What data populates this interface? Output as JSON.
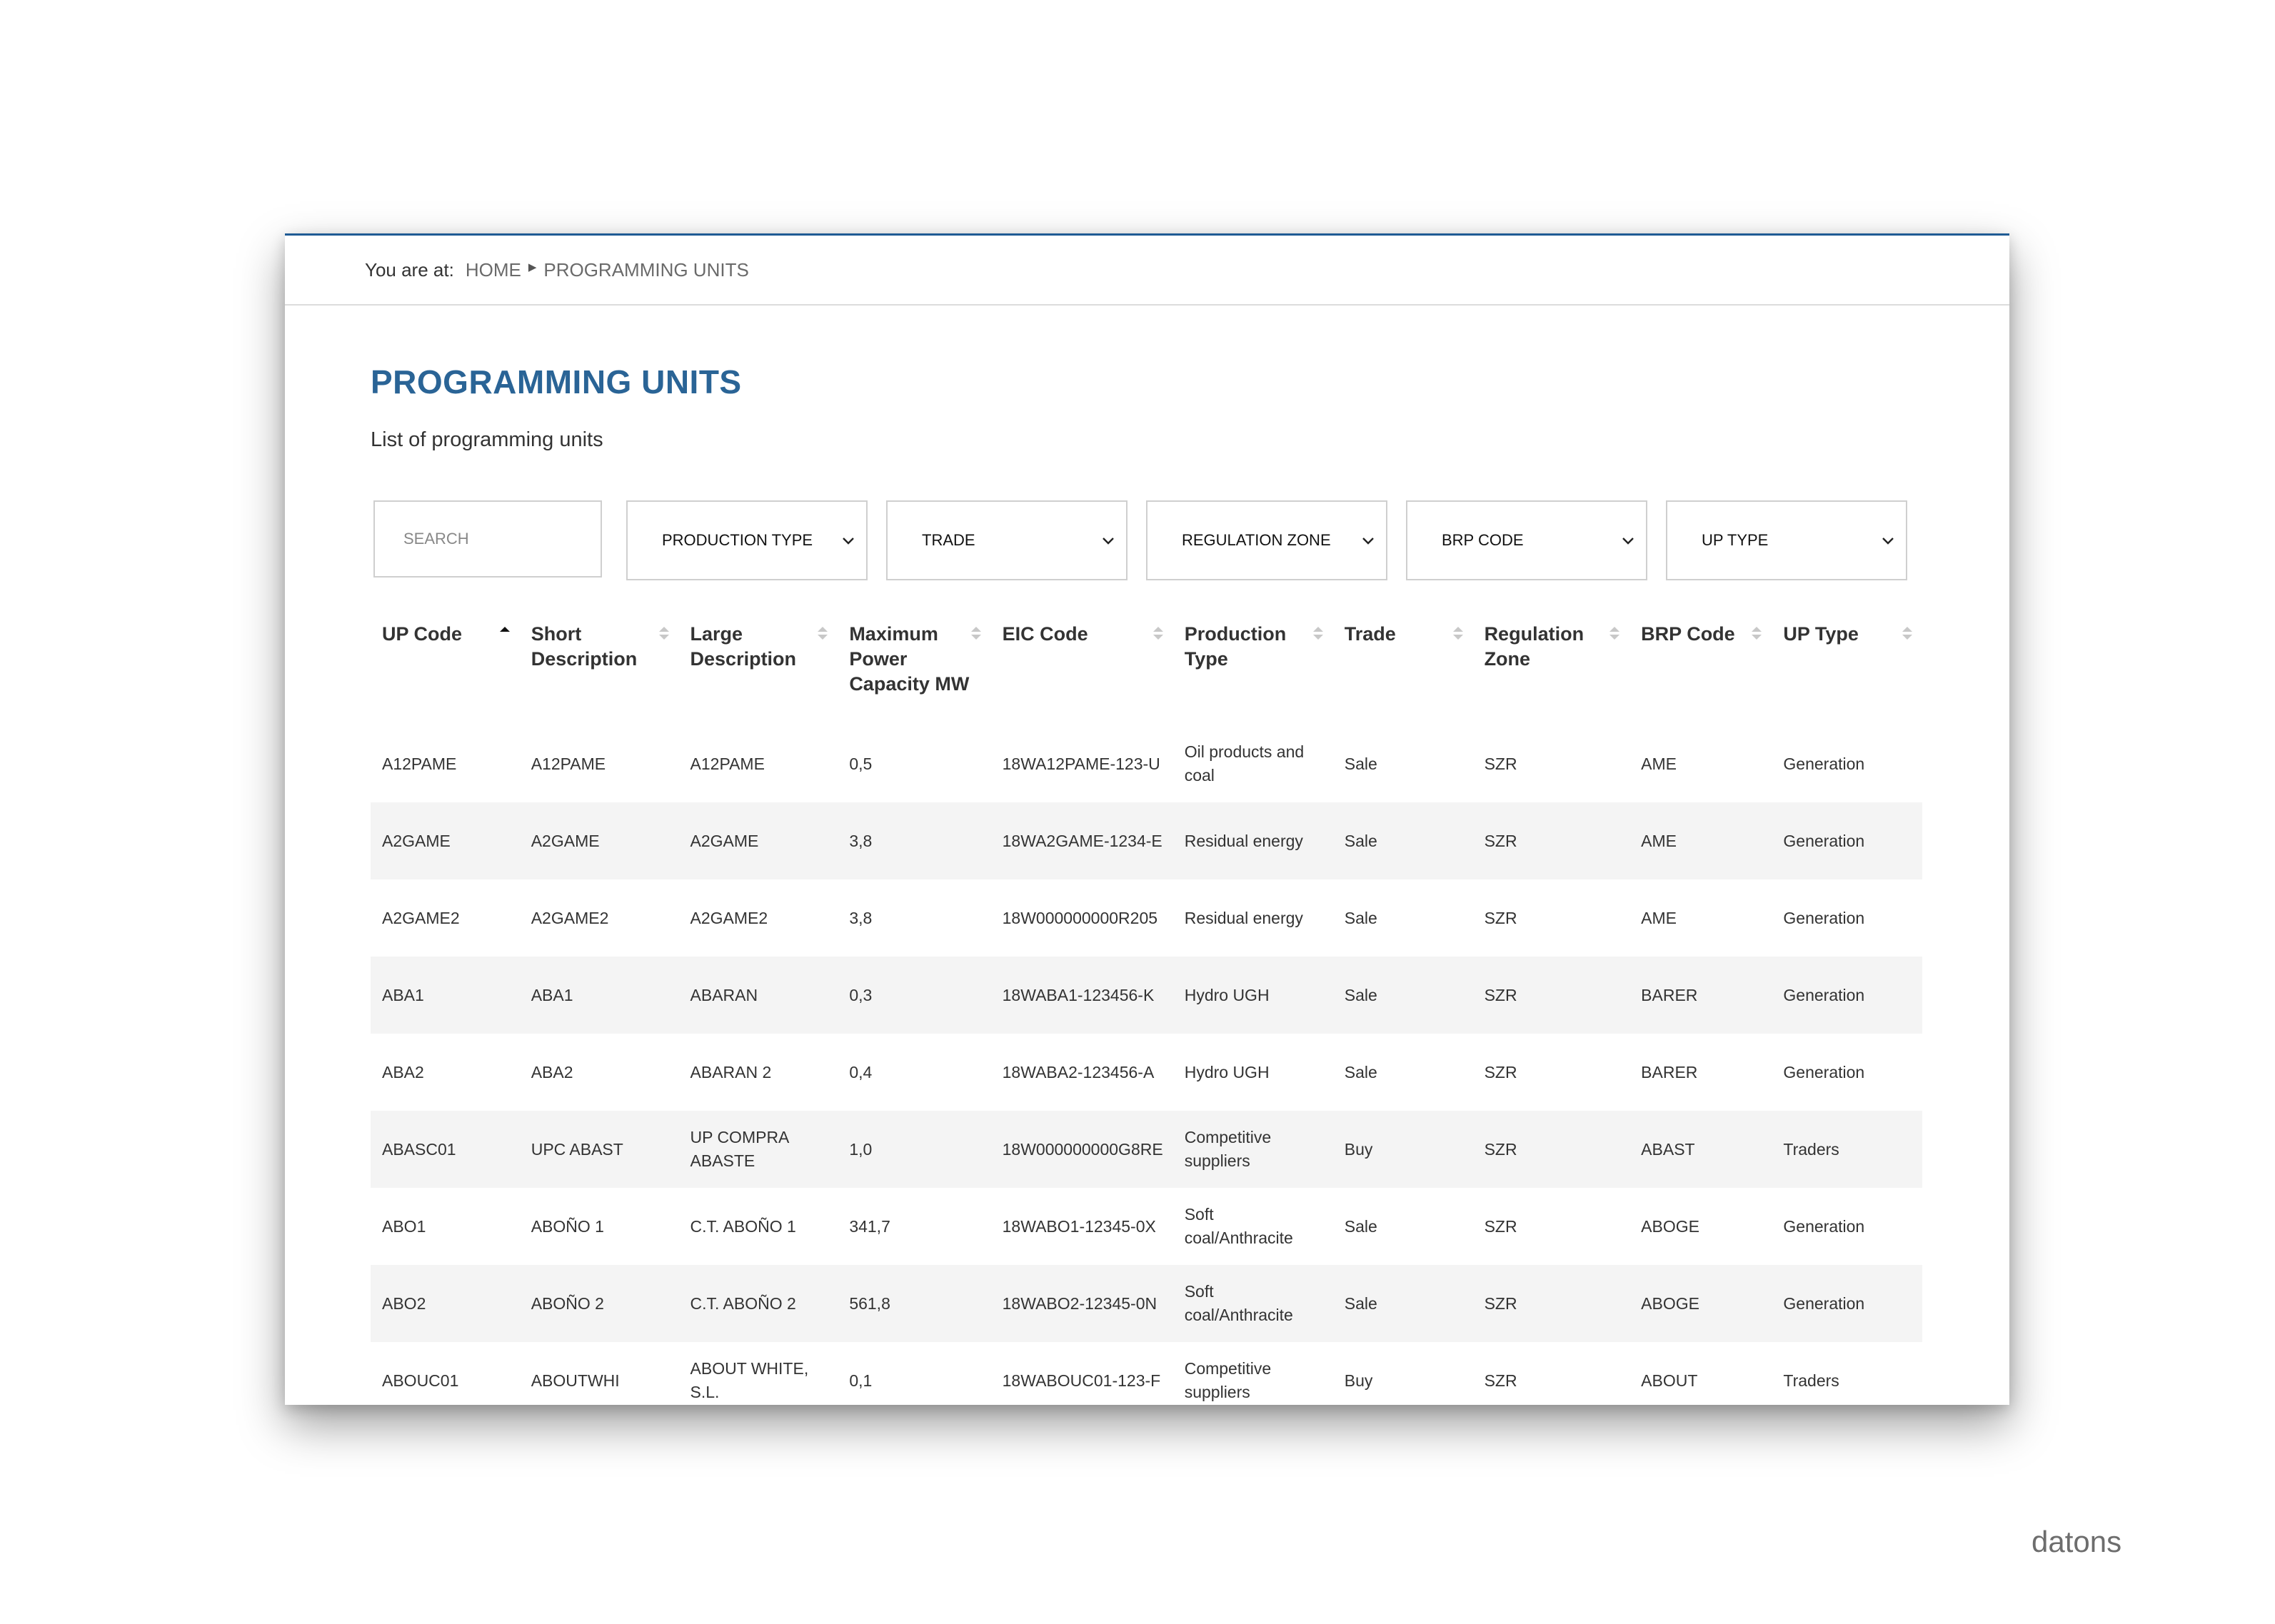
{
  "breadcrumb": {
    "label": "You are at:",
    "items": [
      "HOME",
      "PROGRAMMING UNITS"
    ]
  },
  "page": {
    "title": "PROGRAMMING UNITS",
    "subtitle": "List of programming units"
  },
  "filters": {
    "search_placeholder": "SEARCH",
    "selects": [
      "PRODUCTION TYPE",
      "TRADE",
      "REGULATION ZONE",
      "BRP CODE",
      "UP TYPE"
    ]
  },
  "table": {
    "sorted_column": "UP Code",
    "columns": [
      "UP Code",
      "Short Description",
      "Large Description",
      "Maximum Power Capacity MW",
      "EIC Code",
      "Production Type",
      "Trade",
      "Regulation Zone",
      "BRP Code",
      "UP Type"
    ],
    "rows": [
      [
        "A12PAME",
        "A12PAME",
        "A12PAME",
        "0,5",
        "18WA12PAME-123-U",
        "Oil products and coal",
        "Sale",
        "SZR",
        "AME",
        "Generation"
      ],
      [
        "A2GAME",
        "A2GAME",
        "A2GAME",
        "3,8",
        "18WA2GAME-1234-E",
        "Residual energy",
        "Sale",
        "SZR",
        "AME",
        "Generation"
      ],
      [
        "A2GAME2",
        "A2GAME2",
        "A2GAME2",
        "3,8",
        "18W000000000R205",
        "Residual energy",
        "Sale",
        "SZR",
        "AME",
        "Generation"
      ],
      [
        "ABA1",
        "ABA1",
        "ABARAN",
        "0,3",
        "18WABA1-123456-K",
        "Hydro UGH",
        "Sale",
        "SZR",
        "BARER",
        "Generation"
      ],
      [
        "ABA2",
        "ABA2",
        "ABARAN 2",
        "0,4",
        "18WABA2-123456-A",
        "Hydro UGH",
        "Sale",
        "SZR",
        "BARER",
        "Generation"
      ],
      [
        "ABASC01",
        "UPC ABAST",
        "UP COMPRA ABASTE",
        "1,0",
        "18W000000000G8RE",
        "Competitive suppliers",
        "Buy",
        "SZR",
        "ABAST",
        "Traders"
      ],
      [
        "ABO1",
        "ABOÑO 1",
        "C.T. ABOÑO 1",
        "341,7",
        "18WABO1-12345-0X",
        "Soft coal/Anthracite",
        "Sale",
        "SZR",
        "ABOGE",
        "Generation"
      ],
      [
        "ABO2",
        "ABOÑO 2",
        "C.T. ABOÑO 2",
        "561,8",
        "18WABO2-12345-0N",
        "Soft coal/Anthracite",
        "Sale",
        "SZR",
        "ABOGE",
        "Generation"
      ],
      [
        "ABOUC01",
        "ABOUTWHI",
        "ABOUT WHITE, S.L.",
        "0,1",
        "18WABOUC01-123-F",
        "Competitive suppliers",
        "Buy",
        "SZR",
        "ABOUT",
        "Traders"
      ]
    ]
  },
  "watermark": "datons",
  "colors": {
    "accent": "#2a6496",
    "border": "#1f5b94",
    "row_alt": "#f4f4f4"
  }
}
